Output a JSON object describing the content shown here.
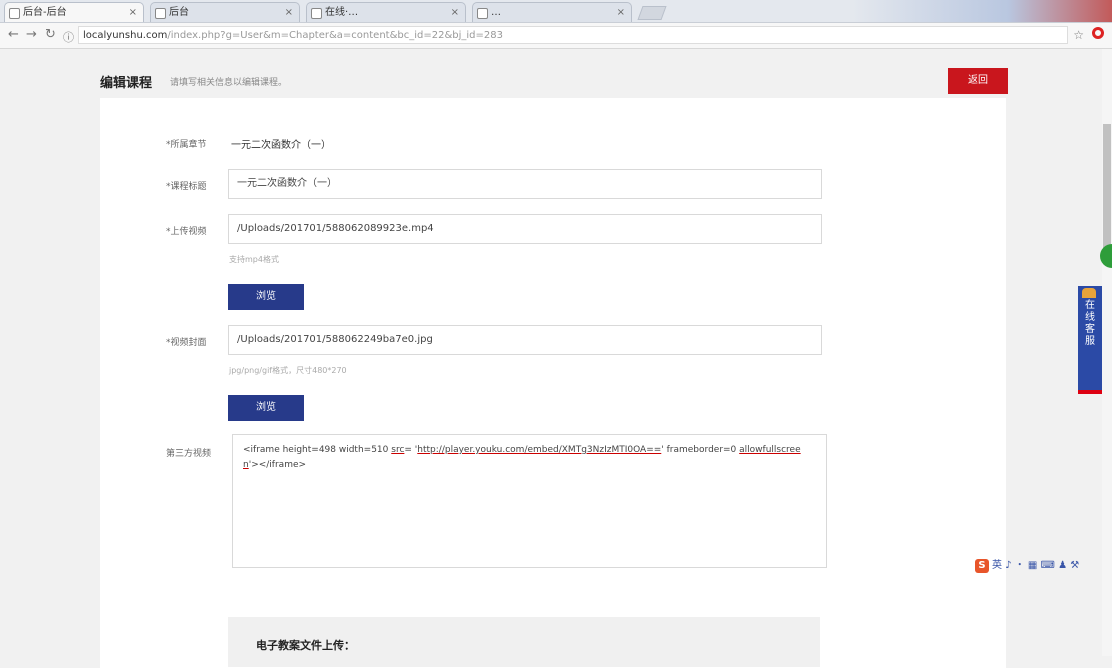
{
  "browser": {
    "tabs": [
      {
        "label": "后台-后台",
        "active": true
      },
      {
        "label": "后台",
        "active": false
      },
      {
        "label": "在线·…",
        "active": false
      },
      {
        "label": "…",
        "active": false
      }
    ],
    "url_host": "localyunshu.com",
    "url_path": "/index.php?g=User&m=Chapter&a=content&bc_id=22&bj_id=283"
  },
  "header": {
    "title": "编辑课程",
    "subtitle": "请填写相关信息以编辑课程。",
    "back_label": "返回"
  },
  "form": {
    "chapter_label": "*所属章节",
    "chapter_value": "一元二次函数介（一）",
    "title_label": "*课程标题",
    "title_value": "一元二次函数介（一）",
    "video_label": "*上传视频",
    "video_value": "/Uploads/201701/588062089923e.mp4",
    "video_hint": "支持mp4格式",
    "video_browse": "浏览",
    "cover_label": "*视频封面",
    "cover_value": "/Uploads/201701/588062249ba7e0.jpg",
    "cover_hint": "jpg/png/gif格式，尺寸480*270",
    "cover_browse": "浏览",
    "thirdparty_label": "第三方视频",
    "thirdparty_tag_open": "<iframe",
    "thirdparty_text1": " height=498 width=510 ",
    "thirdparty_src": "src",
    "thirdparty_eq": "= '",
    "thirdparty_url": "http://player.youku.com/embed/XMTg3NzIzMTI0OA==",
    "thirdparty_text2": "' frameborder=0 ",
    "thirdparty_allow": "allowfullscreen",
    "thirdparty_close": "'></iframe>"
  },
  "upload": {
    "title": "电子教案文件上传："
  },
  "side": {
    "service_label": "在线客服"
  }
}
